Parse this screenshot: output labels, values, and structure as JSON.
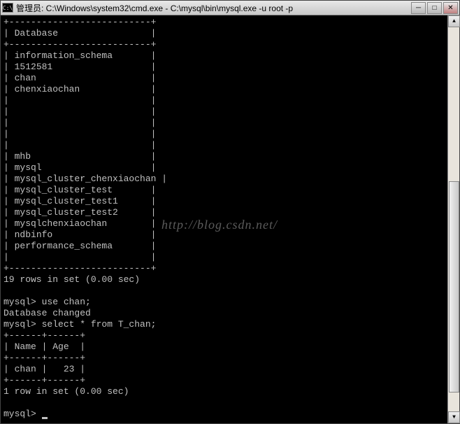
{
  "titlebar": {
    "icon_text": "C:\\",
    "title": "管理员: C:\\Windows\\system32\\cmd.exe - C:\\mysql\\bin\\mysql.exe  -u root -p"
  },
  "watermark": "http://blog.csdn.net/",
  "output": {
    "divider_top": "+--------------------------+",
    "header_row": "| Database                 |",
    "divider_mid": "+--------------------------+",
    "databases_group1": [
      "information_schema",
      "1512581",
      "chan",
      "chenxiaochan"
    ],
    "databases_group2": [
      "mhb",
      "mysql",
      "mysql_cluster_chenxiaochan",
      "mysql_cluster_test",
      "mysql_cluster_test1",
      "mysql_cluster_test2",
      "mysqlchenxiaochan",
      "ndbinfo",
      "performance_schema"
    ],
    "divider_bot": "+--------------------------+",
    "rows_summary": "19 rows in set (0.00 sec)",
    "prompt1": "mysql> ",
    "cmd1": "use chan;",
    "db_changed": "Database changed",
    "prompt2": "mysql> ",
    "cmd2": "select * from T_chan;",
    "tchan_div": "+------+------+",
    "tchan_header": "| Name | Age  |",
    "tchan_row": "| chan |   23 |",
    "tchan_summary": "1 row in set (0.00 sec)",
    "prompt3": "mysql> "
  },
  "chart_data": {
    "type": "table",
    "title": "T_chan",
    "columns": [
      "Name",
      "Age"
    ],
    "rows": [
      [
        "chan",
        23
      ]
    ]
  }
}
